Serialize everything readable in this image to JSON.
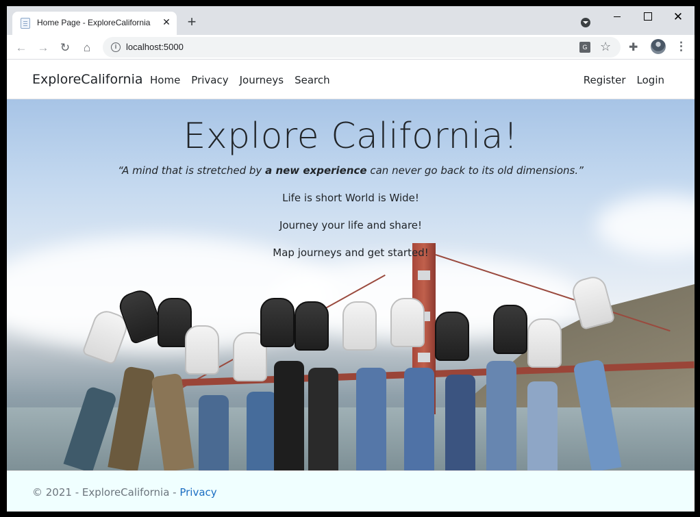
{
  "browser": {
    "tab_title": "Home Page - ExploreCalifornia",
    "tab_close": "✕",
    "new_tab": "+",
    "url": "localhost:5000",
    "back_icon": "arrow-left-icon",
    "forward_icon": "arrow-right-icon",
    "reload_icon": "reload-icon",
    "home_icon": "home-icon"
  },
  "navbar": {
    "brand": "ExploreCalifornia",
    "links": [
      "Home",
      "Privacy",
      "Journeys",
      "Search"
    ],
    "right_links": [
      "Register",
      "Login"
    ]
  },
  "hero": {
    "title": "Explore California!",
    "quote_pre": "“A mind that is stretched by ",
    "quote_bold": "a new experience",
    "quote_post": " can never go back to its old dimensions.”",
    "lines": [
      "Life is short World is Wide!",
      "Journey your life and share!",
      "Map journeys and get started!"
    ]
  },
  "footer": {
    "text": "© 2021 - ExploreCalifornia - ",
    "link": "Privacy"
  },
  "colors": {
    "link": "#1b6ec2",
    "footer_bg": "#f0ffff",
    "tabstrip_bg": "#dee1e6"
  }
}
